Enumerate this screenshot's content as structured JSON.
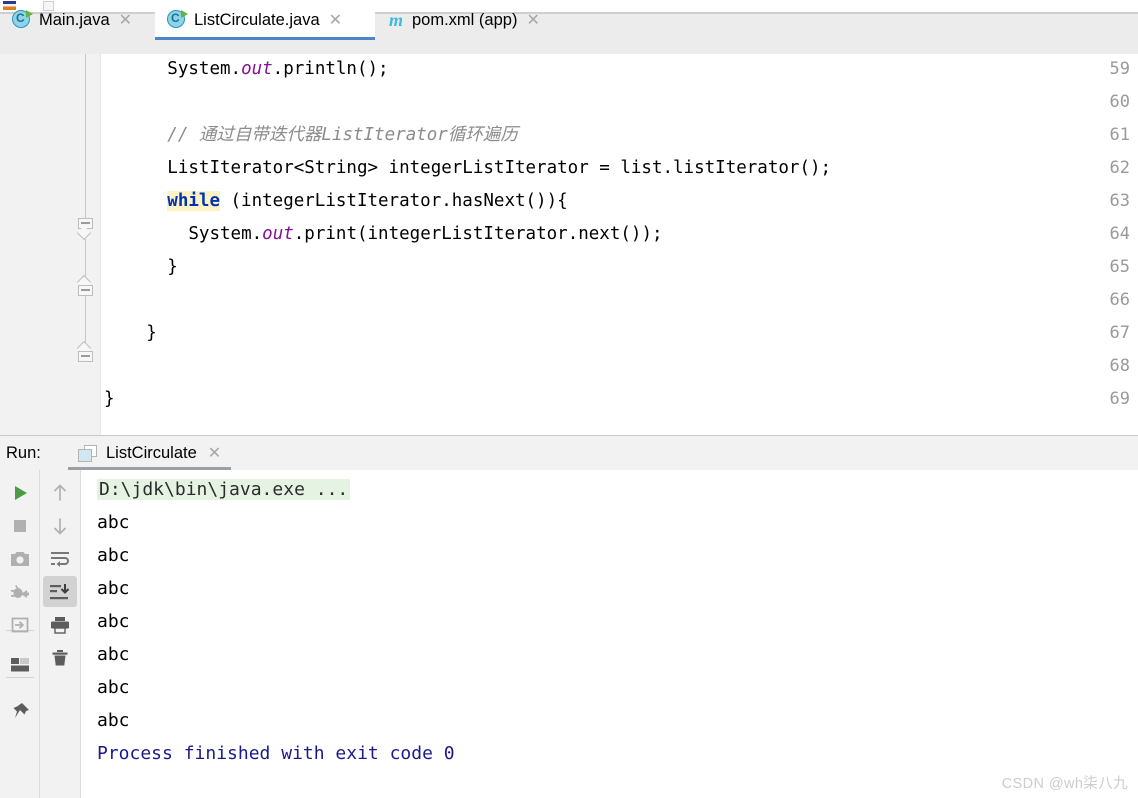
{
  "window": {
    "app": "IntelliJ IDEA",
    "watermark": "CSDN @wh柒八九"
  },
  "editor_tabs": [
    {
      "label": "Main.java",
      "icon": "java-class-icon",
      "close": "✕",
      "active": false
    },
    {
      "label": "ListCirculate.java",
      "icon": "java-class-icon",
      "close": "✕",
      "active": true
    },
    {
      "label": "pom.xml (app)",
      "icon": "maven-icon",
      "close": "✕",
      "active": false
    }
  ],
  "editor": {
    "lines": [
      {
        "num": "59",
        "indent": 6,
        "segments": [
          {
            "text": "System.",
            "type": "plain"
          },
          {
            "text": "out",
            "type": "field"
          },
          {
            "text": ".println();",
            "type": "plain"
          }
        ]
      },
      {
        "num": "60",
        "indent": 0,
        "segments": []
      },
      {
        "num": "61",
        "indent": 6,
        "segments": [
          {
            "text": "// 通过自带迭代器ListIterator循环遍历",
            "type": "comment"
          }
        ]
      },
      {
        "num": "62",
        "indent": 6,
        "segments": [
          {
            "text": "ListIterator<String> integerListIterator = list.listIterator();",
            "type": "plain"
          }
        ]
      },
      {
        "num": "63",
        "indent": 6,
        "segments": [
          {
            "text": "while",
            "type": "keyword"
          },
          {
            "text": " (integerListIterator.hasNext()){",
            "type": "plain"
          }
        ]
      },
      {
        "num": "64",
        "indent": 8,
        "segments": [
          {
            "text": "System.",
            "type": "plain"
          },
          {
            "text": "out",
            "type": "field"
          },
          {
            "text": ".print(integerListIterator.next());",
            "type": "plain"
          }
        ]
      },
      {
        "num": "65",
        "indent": 6,
        "segments": [
          {
            "text": "}",
            "type": "plain"
          }
        ]
      },
      {
        "num": "66",
        "indent": 0,
        "segments": []
      },
      {
        "num": "67",
        "indent": 4,
        "segments": [
          {
            "text": "}",
            "type": "plain"
          }
        ]
      },
      {
        "num": "68",
        "indent": 0,
        "segments": []
      },
      {
        "num": "69",
        "indent": 0,
        "segments": [
          {
            "text": "}",
            "type": "plain"
          }
        ]
      }
    ]
  },
  "run_panel": {
    "label": "Run:",
    "tab_label": "ListCirculate",
    "tab_icon": "console-window-icon",
    "tab_close": "✕"
  },
  "toolbar_left": [
    {
      "name": "rerun-button",
      "icon": "play-icon"
    },
    {
      "name": "stop-button",
      "icon": "stop-square-icon"
    },
    {
      "name": "screenshot-button",
      "icon": "camera-icon"
    },
    {
      "name": "restore-layout-button",
      "icon": "bug-arrow-icon"
    },
    {
      "name": "export-button",
      "icon": "import-arrow-icon"
    },
    {
      "name": "layout-button",
      "icon": "layout-grid-icon"
    },
    {
      "name": "pin-button",
      "icon": "pin-icon"
    }
  ],
  "toolbar_right": [
    {
      "name": "up-button",
      "icon": "arrow-up-icon",
      "active": false
    },
    {
      "name": "down-button",
      "icon": "arrow-down-icon",
      "active": false
    },
    {
      "name": "soft-wrap-button",
      "icon": "soft-wrap-icon",
      "active": false
    },
    {
      "name": "scroll-to-end-button",
      "icon": "scroll-to-end-icon",
      "active": true
    },
    {
      "name": "print-button",
      "icon": "printer-icon",
      "active": false
    },
    {
      "name": "clear-all-button",
      "icon": "trash-icon",
      "active": false
    }
  ],
  "console": {
    "lines": [
      {
        "text": "D:\\jdk\\bin\\java.exe ...",
        "style": "command"
      },
      {
        "text": "abc",
        "style": "normal"
      },
      {
        "text": "abc",
        "style": "normal"
      },
      {
        "text": "abc",
        "style": "normal"
      },
      {
        "text": "abc",
        "style": "normal"
      },
      {
        "text": "abc",
        "style": "normal"
      },
      {
        "text": "abc",
        "style": "normal"
      },
      {
        "text": "abc",
        "style": "normal"
      },
      {
        "text": "Process finished with exit code 0",
        "style": "exit"
      }
    ]
  },
  "colors": {
    "tab_active_underline": "#4a86c5",
    "keyword": "#0033b3",
    "keyword_highlight": "#fdf2c3",
    "field": "#871094",
    "comment": "#8c8c8c",
    "console_command_bg": "#e5f3e2",
    "exit_text": "#1a1a8c",
    "run_green": "#62b543"
  }
}
